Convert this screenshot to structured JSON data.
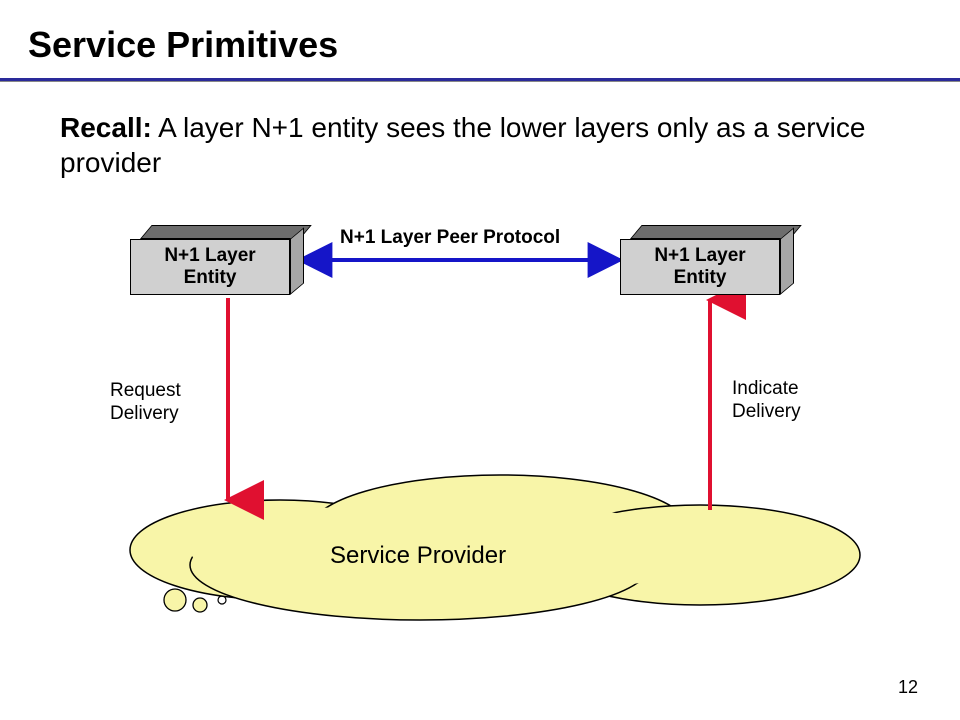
{
  "title": "Service Primitives",
  "recall_bold": "Recall:",
  "recall_text": " A layer N+1 entity sees the lower layers only as a service provider",
  "left_entity_line1": "N+1 Layer",
  "left_entity_line2": "Entity",
  "right_entity_line1": "N+1 Layer",
  "right_entity_line2": "Entity",
  "peer_protocol": "N+1 Layer Peer Protocol",
  "request_line1": "Request",
  "request_line2": "Delivery",
  "indicate_line1": "Indicate",
  "indicate_line2": "Delivery",
  "cloud": "Service Provider",
  "page": "12",
  "colors": {
    "blue_arrow": "#1515c8",
    "red_arrow": "#e01030",
    "cloud_fill": "#f8f5a8",
    "cloud_stroke": "#000000"
  }
}
